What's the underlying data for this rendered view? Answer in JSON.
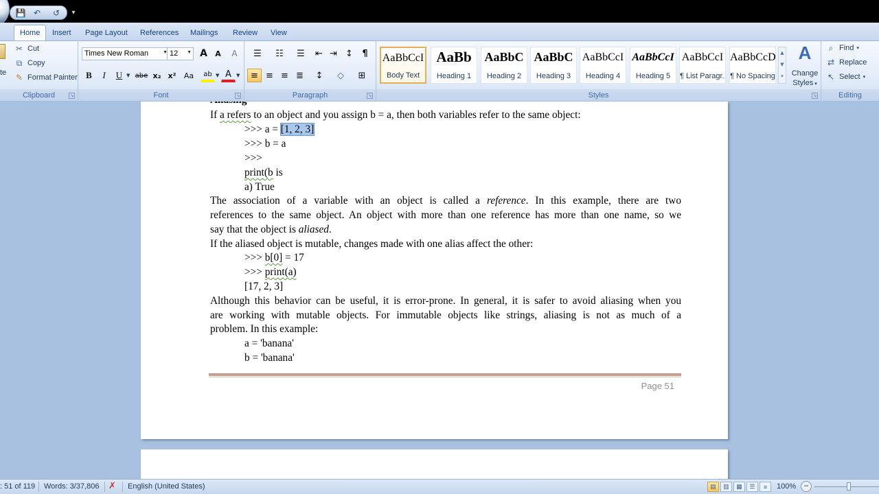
{
  "titlebar": {
    "qat_icons": [
      "save-icon",
      "undo-icon",
      "redo-icon"
    ],
    "qat_glyphs": [
      "💾",
      "↶",
      "↺"
    ]
  },
  "tabs": [
    {
      "label": "Home",
      "active": true
    },
    {
      "label": "Insert",
      "active": false
    },
    {
      "label": "Page Layout",
      "active": false
    },
    {
      "label": "References",
      "active": false
    },
    {
      "label": "Mailings",
      "active": false
    },
    {
      "label": "Review",
      "active": false
    },
    {
      "label": "View",
      "active": false
    }
  ],
  "clipboard": {
    "paste_label": "te",
    "cut_label": "Cut",
    "copy_label": "Copy",
    "format_painter_label": "Format Painter",
    "group_label": "Clipboard"
  },
  "font": {
    "font_name": "Times New Roman",
    "font_size": "12",
    "grow_glyph": "A",
    "shrink_glyph": "A",
    "clear_glyph": "A",
    "bold_glyph": "B",
    "italic_glyph": "I",
    "underline_glyph": "U",
    "strike_glyph": "abe",
    "subscript_glyph": "x₂",
    "superscript_glyph": "x²",
    "case_glyph": "Aa",
    "highlight_glyph": "ab",
    "font_color_glyph": "A",
    "group_label": "Font"
  },
  "paragraph": {
    "bullets_glyph": "☰",
    "numbering_glyph": "☷",
    "multilevel_glyph": "☰",
    "decrease_indent_glyph": "⇤",
    "increase_indent_glyph": "⇥",
    "sort_glyph": "↕",
    "pilcrow_glyph": "¶",
    "align_left_glyph": "≡",
    "align_center_glyph": "≡",
    "align_right_glyph": "≡",
    "justify_glyph": "≣",
    "line_spacing_glyph": "↕",
    "shading_glyph": "◇",
    "borders_glyph": "⊞",
    "group_label": "Paragraph"
  },
  "styles": {
    "items": [
      {
        "sample": "AaBbCcI",
        "name": "Body Text",
        "active": true
      },
      {
        "sample": "AaBb",
        "name": "Heading 1",
        "active": false
      },
      {
        "sample": "AaBbC",
        "name": "Heading 2",
        "active": false
      },
      {
        "sample": "AaBbC",
        "name": "Heading 3",
        "active": false
      },
      {
        "sample": "AaBbCcI",
        "name": "Heading 4",
        "active": false
      },
      {
        "sample": "AaBbCcI",
        "name": "Heading 5",
        "active": false
      },
      {
        "sample": "AaBbCcI",
        "name": "¶ List Paragr...",
        "active": false
      },
      {
        "sample": "AaBbCcD",
        "name": "¶ No Spacing",
        "active": false
      }
    ],
    "change_styles_line1": "Change",
    "change_styles_line2": "Styles",
    "change_styles_glyph": "A",
    "group_label": "Styles"
  },
  "editing": {
    "find_label": "Find",
    "replace_label": "Replace",
    "select_label": "Select",
    "group_label": "Editing"
  },
  "document": {
    "clipped_line": "Aliasing",
    "line1": {
      "a": "If ",
      "b": "a refers",
      "c": " to an object and you assign b = a, then both variables refer to the same object:"
    },
    "line2": {
      "a": ">>> a = ",
      "b": "[1, 2, 3]"
    },
    "line3": ">>> b = a",
    "line4": ">>>",
    "line5": {
      "a": "print(b",
      "b": " is"
    },
    "line6": "a) True",
    "para1_l1": {
      "a": "The association of a variable with an object is called a ",
      "b": "reference",
      "c": ". In this example, there are two"
    },
    "para1_l2": "references to the same object. An object with more than one reference has more than one name, so we",
    "para1_l3": {
      "a": "say that the object is ",
      "b": "aliased",
      "c": "."
    },
    "line7": "If the aliased object is mutable, changes made with one alias affect the other:",
    "line8": {
      "a": ">>> ",
      "b": "b[0]",
      "c": " = 17"
    },
    "line9": {
      "a": ">>> ",
      "b": "print(a)"
    },
    "line10": "[17, 2, 3]",
    "para2_l1": "Although this behavior can be useful, it is error-prone. In general, it is safer to avoid aliasing when you",
    "para2_l2": "are working with mutable objects. For immutable objects like strings, aliasing is not as much of a",
    "para2_l3": "problem. In this example:",
    "line11": "a = 'banana'",
    "line12": "b = 'banana'",
    "page_number": "Page 51"
  },
  "status": {
    "page": ": 51 of 119",
    "words": "Words: 3/37,806",
    "language": "English (United States)",
    "zoom": "100%",
    "zoom_minus": "−"
  },
  "colors": {
    "ribbon_text": "#1e395b",
    "selection": "#a8c7ec",
    "footer_rule": "#c69b8e"
  }
}
